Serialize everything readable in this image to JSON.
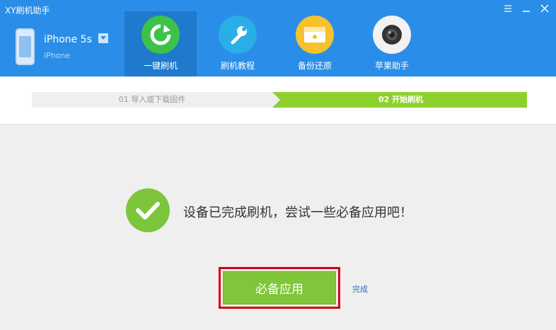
{
  "app": {
    "title": "XY刷机助手"
  },
  "device": {
    "name": "iPhone 5s",
    "type": "iPhone"
  },
  "nav": [
    {
      "label": "一键刷机",
      "icon": "refresh-icon",
      "active": true,
      "color": "#3cc24a"
    },
    {
      "label": "刷机教程",
      "icon": "wrench-icon",
      "active": false,
      "color": "#29aee8"
    },
    {
      "label": "备份还原",
      "icon": "backup-icon",
      "active": false,
      "color": "#f5c22b"
    },
    {
      "label": "苹果助手",
      "icon": "camera-icon",
      "active": false,
      "color": "#f2f2f2"
    }
  ],
  "steps": {
    "step1": "01 导入或下载固件",
    "step2": "02 开始刷机"
  },
  "content": {
    "message": "设备已完成刷机，尝试一些必备应用吧！",
    "primary_button": "必备应用",
    "done_link": "完成"
  },
  "colors": {
    "header": "#2a8ee8",
    "accent_green": "#8ed12f",
    "highlight": "#d9000d"
  }
}
